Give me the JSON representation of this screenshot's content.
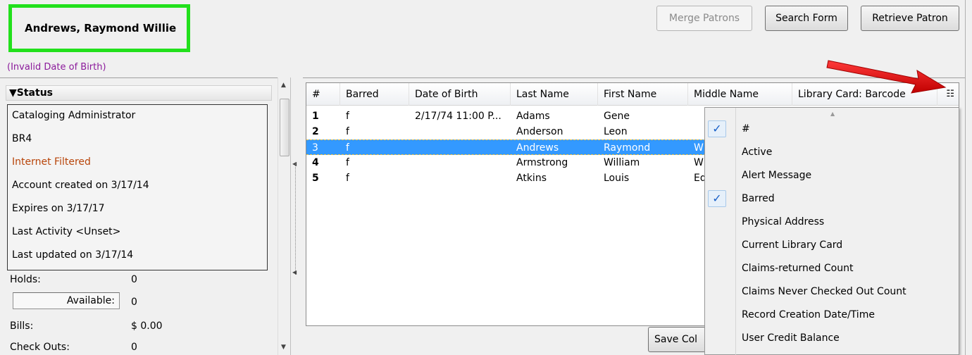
{
  "patron": {
    "name": "Andrews, Raymond Willie",
    "dob_warning": "(Invalid Date of Birth)"
  },
  "toolbar": {
    "merge_label": "Merge Patrons",
    "search_label": "Search Form",
    "retrieve_label": "Retrieve Patron"
  },
  "status": {
    "header": "Status",
    "lines": [
      "Cataloging Administrator",
      "BR4",
      "Internet Filtered",
      "Account created on 3/17/14",
      "Expires on 3/17/17",
      "Last Activity <Unset>",
      "Last updated on 3/17/14"
    ],
    "holds_label": "Holds:",
    "holds_value": "0",
    "available_label": "Available:",
    "available_value": "0",
    "bills_label": "Bills:",
    "bills_value": "$ 0.00",
    "checkouts_label": "Check Outs:",
    "checkouts_value": "0"
  },
  "grid": {
    "columns": [
      "#",
      "Barred",
      "Date of Birth",
      "Last Name",
      "First Name",
      "Middle Name",
      "Library Card: Barcode"
    ],
    "rows": [
      {
        "num": "1",
        "barred": "f",
        "dob": "2/17/74 11:00 P...",
        "last": "Adams",
        "first": "Gene",
        "middle": ""
      },
      {
        "num": "2",
        "barred": "f",
        "dob": "",
        "last": "Anderson",
        "first": "Leon",
        "middle": ""
      },
      {
        "num": "3",
        "barred": "f",
        "dob": "",
        "last": "Andrews",
        "first": "Raymond",
        "middle": "W"
      },
      {
        "num": "4",
        "barred": "f",
        "dob": "",
        "last": "Armstrong",
        "first": "William",
        "middle": "W"
      },
      {
        "num": "5",
        "barred": "f",
        "dob": "",
        "last": "Atkins",
        "first": "Louis",
        "middle": "Ed"
      }
    ],
    "selected_row": 2,
    "save_label": "Save Col"
  },
  "column_menu": {
    "items": [
      {
        "label": "#",
        "checked": true
      },
      {
        "label": "Active",
        "checked": false
      },
      {
        "label": "Alert Message",
        "checked": false
      },
      {
        "label": "Barred",
        "checked": true
      },
      {
        "label": "Physical Address",
        "checked": false
      },
      {
        "label": "Current Library Card",
        "checked": false
      },
      {
        "label": "Claims-returned Count",
        "checked": false
      },
      {
        "label": "Claims Never Checked Out Count",
        "checked": false
      },
      {
        "label": "Record Creation Date/Time",
        "checked": false
      },
      {
        "label": "User Credit Balance",
        "checked": false
      }
    ]
  },
  "colors": {
    "highlight_border": "#22e01c",
    "dob_warning": "#8b1a9b",
    "internet_filtered": "#b8450a",
    "selection": "#3399ff",
    "annotation_arrow": "#e01010"
  }
}
